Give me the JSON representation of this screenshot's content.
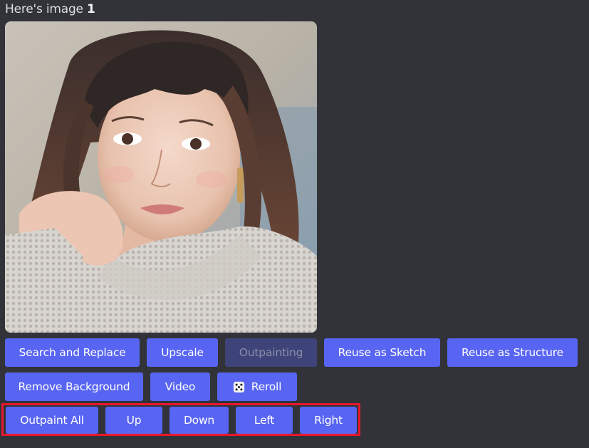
{
  "message": {
    "caption_prefix": "Here's image",
    "caption_number": "1"
  },
  "buttons_row1": [
    {
      "label": "Search and Replace",
      "enabled": true
    },
    {
      "label": "Upscale",
      "enabled": true
    },
    {
      "label": "Outpainting",
      "enabled": false
    },
    {
      "label": "Reuse as Sketch",
      "enabled": true
    },
    {
      "label": "Reuse as Structure",
      "enabled": true
    }
  ],
  "buttons_row2": [
    {
      "label": "Remove Background",
      "enabled": true
    },
    {
      "label": "Video",
      "enabled": true
    },
    {
      "label": "Reroll",
      "icon": "dice-icon",
      "enabled": true
    }
  ],
  "buttons_row3": [
    {
      "label": "Outpaint All"
    },
    {
      "label": "Up"
    },
    {
      "label": "Down"
    },
    {
      "label": "Left"
    },
    {
      "label": "Right"
    }
  ],
  "colors": {
    "background": "#313338",
    "button_primary": "#5865f2",
    "button_disabled": "#3e4479",
    "highlight": "#e8182e"
  }
}
